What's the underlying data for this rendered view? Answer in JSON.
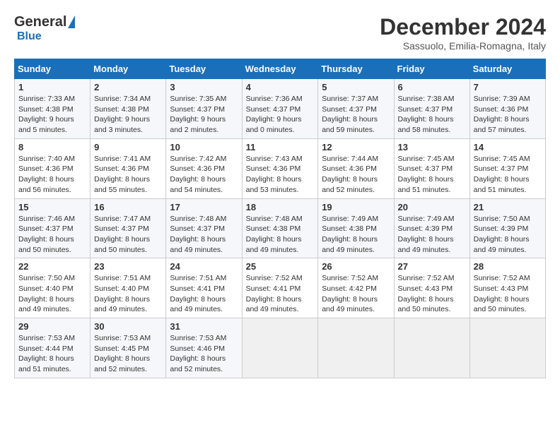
{
  "logo": {
    "general": "General",
    "blue": "Blue"
  },
  "title": "December 2024",
  "subtitle": "Sassuolo, Emilia-Romagna, Italy",
  "days_of_week": [
    "Sunday",
    "Monday",
    "Tuesday",
    "Wednesday",
    "Thursday",
    "Friday",
    "Saturday"
  ],
  "weeks": [
    [
      {
        "day": "1",
        "sunrise": "7:33 AM",
        "sunset": "4:38 PM",
        "daylight": "9 hours and 5 minutes."
      },
      {
        "day": "2",
        "sunrise": "7:34 AM",
        "sunset": "4:38 PM",
        "daylight": "9 hours and 3 minutes."
      },
      {
        "day": "3",
        "sunrise": "7:35 AM",
        "sunset": "4:37 PM",
        "daylight": "9 hours and 2 minutes."
      },
      {
        "day": "4",
        "sunrise": "7:36 AM",
        "sunset": "4:37 PM",
        "daylight": "9 hours and 0 minutes."
      },
      {
        "day": "5",
        "sunrise": "7:37 AM",
        "sunset": "4:37 PM",
        "daylight": "8 hours and 59 minutes."
      },
      {
        "day": "6",
        "sunrise": "7:38 AM",
        "sunset": "4:37 PM",
        "daylight": "8 hours and 58 minutes."
      },
      {
        "day": "7",
        "sunrise": "7:39 AM",
        "sunset": "4:36 PM",
        "daylight": "8 hours and 57 minutes."
      }
    ],
    [
      {
        "day": "8",
        "sunrise": "7:40 AM",
        "sunset": "4:36 PM",
        "daylight": "8 hours and 56 minutes."
      },
      {
        "day": "9",
        "sunrise": "7:41 AM",
        "sunset": "4:36 PM",
        "daylight": "8 hours and 55 minutes."
      },
      {
        "day": "10",
        "sunrise": "7:42 AM",
        "sunset": "4:36 PM",
        "daylight": "8 hours and 54 minutes."
      },
      {
        "day": "11",
        "sunrise": "7:43 AM",
        "sunset": "4:36 PM",
        "daylight": "8 hours and 53 minutes."
      },
      {
        "day": "12",
        "sunrise": "7:44 AM",
        "sunset": "4:36 PM",
        "daylight": "8 hours and 52 minutes."
      },
      {
        "day": "13",
        "sunrise": "7:45 AM",
        "sunset": "4:37 PM",
        "daylight": "8 hours and 51 minutes."
      },
      {
        "day": "14",
        "sunrise": "7:45 AM",
        "sunset": "4:37 PM",
        "daylight": "8 hours and 51 minutes."
      }
    ],
    [
      {
        "day": "15",
        "sunrise": "7:46 AM",
        "sunset": "4:37 PM",
        "daylight": "8 hours and 50 minutes."
      },
      {
        "day": "16",
        "sunrise": "7:47 AM",
        "sunset": "4:37 PM",
        "daylight": "8 hours and 50 minutes."
      },
      {
        "day": "17",
        "sunrise": "7:48 AM",
        "sunset": "4:37 PM",
        "daylight": "8 hours and 49 minutes."
      },
      {
        "day": "18",
        "sunrise": "7:48 AM",
        "sunset": "4:38 PM",
        "daylight": "8 hours and 49 minutes."
      },
      {
        "day": "19",
        "sunrise": "7:49 AM",
        "sunset": "4:38 PM",
        "daylight": "8 hours and 49 minutes."
      },
      {
        "day": "20",
        "sunrise": "7:49 AM",
        "sunset": "4:39 PM",
        "daylight": "8 hours and 49 minutes."
      },
      {
        "day": "21",
        "sunrise": "7:50 AM",
        "sunset": "4:39 PM",
        "daylight": "8 hours and 49 minutes."
      }
    ],
    [
      {
        "day": "22",
        "sunrise": "7:50 AM",
        "sunset": "4:40 PM",
        "daylight": "8 hours and 49 minutes."
      },
      {
        "day": "23",
        "sunrise": "7:51 AM",
        "sunset": "4:40 PM",
        "daylight": "8 hours and 49 minutes."
      },
      {
        "day": "24",
        "sunrise": "7:51 AM",
        "sunset": "4:41 PM",
        "daylight": "8 hours and 49 minutes."
      },
      {
        "day": "25",
        "sunrise": "7:52 AM",
        "sunset": "4:41 PM",
        "daylight": "8 hours and 49 minutes."
      },
      {
        "day": "26",
        "sunrise": "7:52 AM",
        "sunset": "4:42 PM",
        "daylight": "8 hours and 49 minutes."
      },
      {
        "day": "27",
        "sunrise": "7:52 AM",
        "sunset": "4:43 PM",
        "daylight": "8 hours and 50 minutes."
      },
      {
        "day": "28",
        "sunrise": "7:52 AM",
        "sunset": "4:43 PM",
        "daylight": "8 hours and 50 minutes."
      }
    ],
    [
      {
        "day": "29",
        "sunrise": "7:53 AM",
        "sunset": "4:44 PM",
        "daylight": "8 hours and 51 minutes."
      },
      {
        "day": "30",
        "sunrise": "7:53 AM",
        "sunset": "4:45 PM",
        "daylight": "8 hours and 52 minutes."
      },
      {
        "day": "31",
        "sunrise": "7:53 AM",
        "sunset": "4:46 PM",
        "daylight": "8 hours and 52 minutes."
      },
      null,
      null,
      null,
      null
    ]
  ]
}
